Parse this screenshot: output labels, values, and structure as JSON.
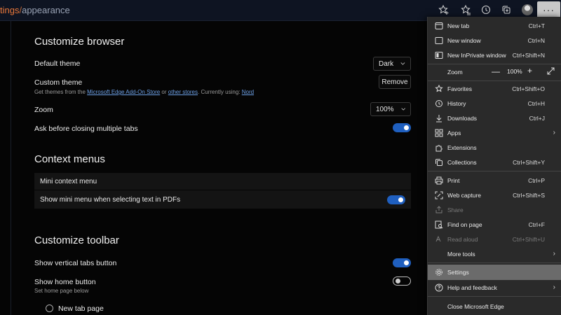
{
  "address": {
    "path": "tings",
    "sep": "/",
    "page": "appearance"
  },
  "toolbar_icons": [
    "favorites-add-icon",
    "favorites-icon",
    "history-icon",
    "collections-icon",
    "profile-avatar",
    "more-dots-icon"
  ],
  "more_label": "···",
  "settings": {
    "customize_browser": {
      "heading": "Customize browser",
      "default_theme": {
        "label": "Default theme",
        "value": "Dark"
      },
      "custom_theme": {
        "label": "Custom theme",
        "desc_prefix": "Get themes from the ",
        "link1": "Microsoft Edge Add-On Store",
        "desc_mid": " or ",
        "link2": "other stores",
        "desc_mid2": ". Currently using: ",
        "link3": "Nord",
        "remove_label": "Remove"
      },
      "zoom": {
        "label": "Zoom",
        "value": "100%"
      },
      "ask_close": {
        "label": "Ask before closing multiple tabs",
        "on": true
      }
    },
    "context_menus": {
      "heading": "Context menus",
      "mini_label": "Mini context menu",
      "pdf_label": "Show mini menu when selecting text in PDFs",
      "pdf_on": true
    },
    "customize_toolbar": {
      "heading": "Customize toolbar",
      "vertical_tabs": {
        "label": "Show vertical tabs button",
        "on": true
      },
      "home_button": {
        "label": "Show home button",
        "desc": "Set home page below",
        "on": false
      },
      "new_tab_option": "New tab page"
    }
  },
  "menu": {
    "new_tab": {
      "label": "New tab",
      "shortcut": "Ctrl+T",
      "icon": "new-tab-icon"
    },
    "new_window": {
      "label": "New window",
      "shortcut": "Ctrl+N",
      "icon": "new-window-icon"
    },
    "new_inprivate": {
      "label": "New InPrivate window",
      "shortcut": "Ctrl+Shift+N",
      "icon": "inprivate-icon"
    },
    "zoom": {
      "label": "Zoom",
      "value": "100%",
      "minus": "—",
      "plus": "+"
    },
    "favorites": {
      "label": "Favorites",
      "shortcut": "Ctrl+Shift+O"
    },
    "history": {
      "label": "History",
      "shortcut": "Ctrl+H"
    },
    "downloads": {
      "label": "Downloads",
      "shortcut": "Ctrl+J"
    },
    "apps": {
      "label": "Apps"
    },
    "extensions": {
      "label": "Extensions"
    },
    "collections": {
      "label": "Collections",
      "shortcut": "Ctrl+Shift+Y"
    },
    "print": {
      "label": "Print",
      "shortcut": "Ctrl+P"
    },
    "web_capture": {
      "label": "Web capture",
      "shortcut": "Ctrl+Shift+S"
    },
    "share": {
      "label": "Share"
    },
    "find": {
      "label": "Find on page",
      "shortcut": "Ctrl+F"
    },
    "read_aloud": {
      "label": "Read aloud",
      "shortcut": "Ctrl+Shift+U"
    },
    "more_tools": {
      "label": "More tools"
    },
    "settings": {
      "label": "Settings"
    },
    "help": {
      "label": "Help and feedback"
    },
    "close": {
      "label": "Close Microsoft Edge"
    }
  },
  "colors": {
    "accent": "#1f5fbf",
    "link": "#6da0e6",
    "menu_bg": "#2a2a2a",
    "highlight": "#6b6b6b"
  }
}
